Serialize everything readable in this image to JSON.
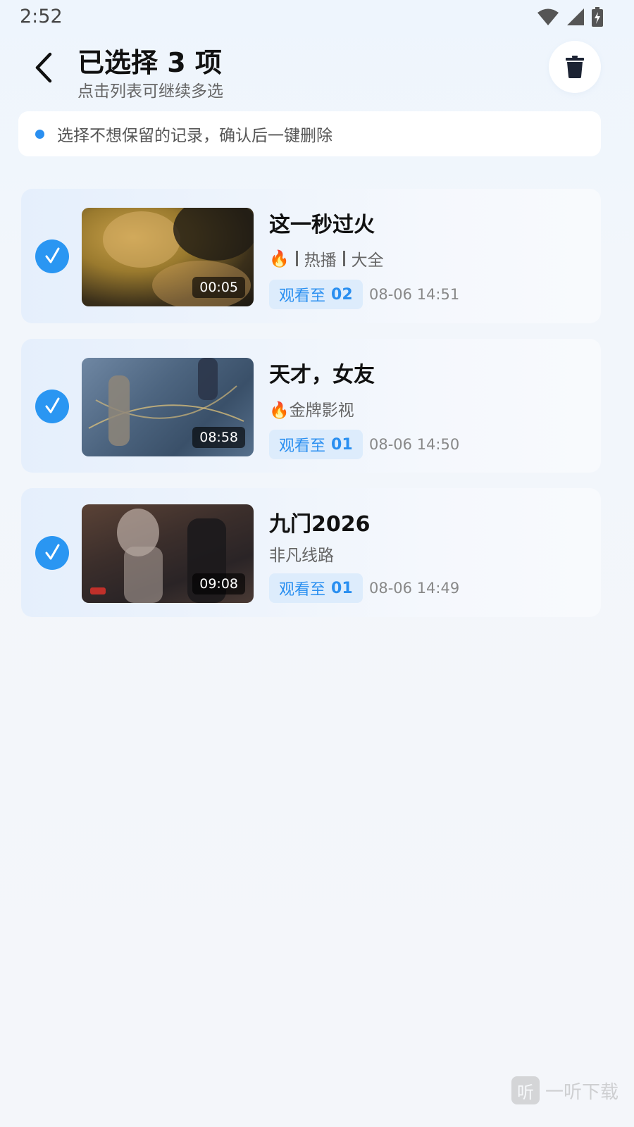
{
  "status_bar": {
    "time": "2:52",
    "icons": [
      "wifi-icon",
      "signal-icon",
      "battery-charging-icon"
    ]
  },
  "header": {
    "title": "已选择 3 项",
    "subtitle": "点击列表可继续多选",
    "back_icon": "chevron-left-icon",
    "delete_icon": "trash-icon"
  },
  "tip": {
    "text": "选择不想保留的记录，确认后一键删除"
  },
  "items": [
    {
      "title": "这一秒过火",
      "duration": "00:05",
      "meta_parts": [
        "🔥",
        "热播",
        "大全"
      ],
      "watch_prefix": "观看至",
      "episode": "02",
      "timestamp": "08-06 14:51",
      "selected": true
    },
    {
      "title": "天才，女友",
      "duration": "08:58",
      "meta": "🔥金牌影视",
      "watch_prefix": "观看至",
      "episode": "01",
      "timestamp": "08-06 14:50",
      "selected": true
    },
    {
      "title": "九门2026",
      "duration": "09:08",
      "meta": "非凡线路",
      "watch_prefix": "观看至",
      "episode": "01",
      "timestamp": "08-06 14:49",
      "selected": true
    }
  ],
  "watermark": {
    "icon_char": "听",
    "text": "一听下载"
  },
  "colors": {
    "accent": "#2a96f2",
    "badge_bg": "#ddecfc",
    "background": "#f4f6fa"
  }
}
